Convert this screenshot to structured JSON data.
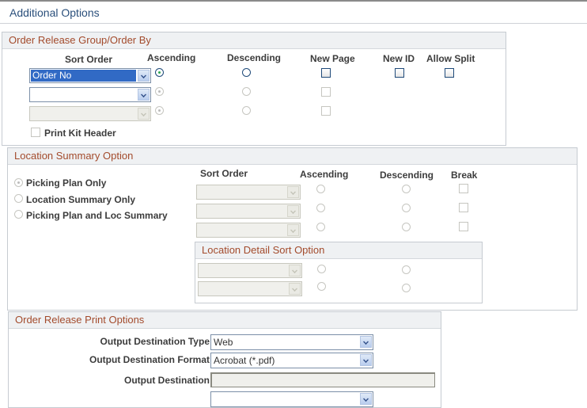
{
  "page": {
    "title": "Additional Options"
  },
  "order_release_group": {
    "header": "Order Release Group/Order By",
    "columns": {
      "sort_order": "Sort Order",
      "ascending": "Ascending",
      "descending": "Descending",
      "new_page": "New Page",
      "new_id": "New ID",
      "allow_split": "Allow Split"
    },
    "rows": [
      {
        "sort_value": "Order No",
        "ascending": true,
        "enabled": true
      },
      {
        "sort_value": "",
        "ascending": true,
        "enabled": true
      },
      {
        "sort_value": "",
        "ascending": true,
        "enabled": false
      }
    ],
    "print_kit_header": "Print Kit Header"
  },
  "location_summary": {
    "header": "Location Summary Option",
    "options": [
      "Picking Plan Only",
      "Location Summary Only",
      "Picking Plan and Loc Summary"
    ],
    "selected": "Picking Plan Only",
    "columns": {
      "sort_order": "Sort Order",
      "ascending": "Ascending",
      "descending": "Descending",
      "break": "Break"
    },
    "detail_header": "Location Detail Sort Option"
  },
  "print_options": {
    "header": "Order Release Print Options",
    "output_destination_type_label": "Output Destination Type",
    "output_destination_type": "Web",
    "output_destination_format_label": "Output Destination Format",
    "output_destination_format": "Acrobat (*.pdf)",
    "output_destination_label": "Output Destination",
    "output_destination": ""
  }
}
